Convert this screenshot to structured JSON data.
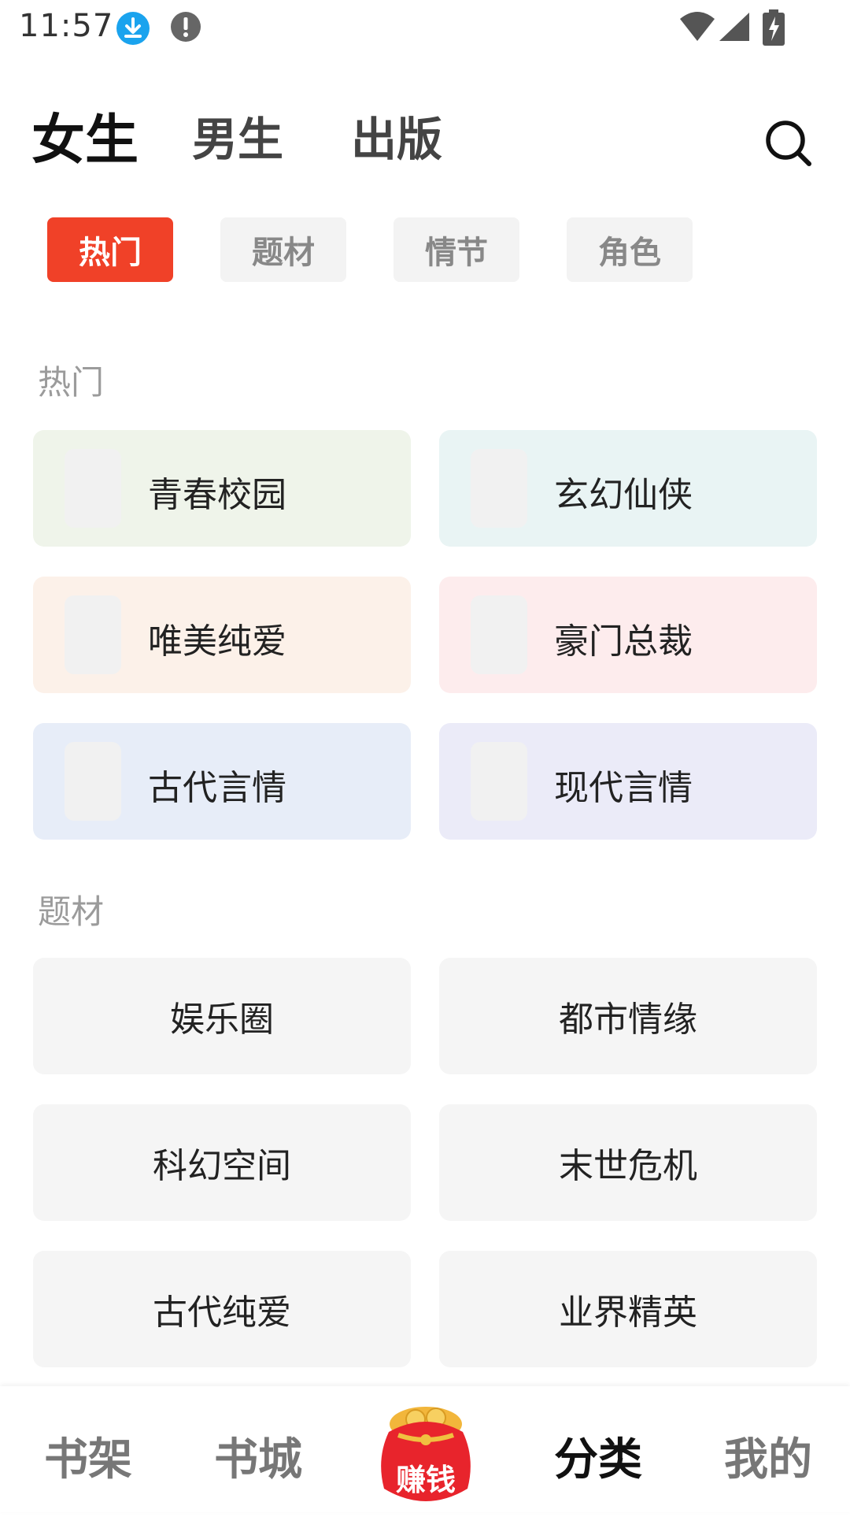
{
  "status_bar": {
    "time": "11:57",
    "icons": [
      "download-icon",
      "alert-icon",
      "wifi-icon",
      "signal-icon",
      "battery-charging-icon"
    ]
  },
  "top_tabs": [
    {
      "label": "女生",
      "active": true
    },
    {
      "label": "男生",
      "active": false
    },
    {
      "label": "出版",
      "active": false
    }
  ],
  "sub_tabs": [
    {
      "label": "热门",
      "active": true
    },
    {
      "label": "题材",
      "active": false
    },
    {
      "label": "情节",
      "active": false
    },
    {
      "label": "角色",
      "active": false
    }
  ],
  "hot_section": {
    "title": "热门",
    "items": [
      {
        "label": "青春校园",
        "bg": "#eff4ea"
      },
      {
        "label": "玄幻仙侠",
        "bg": "#e9f4f4"
      },
      {
        "label": "唯美纯爱",
        "bg": "#fcf1e9"
      },
      {
        "label": "豪门总裁",
        "bg": "#fdeced"
      },
      {
        "label": "古代言情",
        "bg": "#e7edf8"
      },
      {
        "label": "现代言情",
        "bg": "#ebebf8"
      }
    ]
  },
  "genre_section": {
    "title": "题材",
    "items": [
      {
        "label": "娱乐圈"
      },
      {
        "label": "都市情缘"
      },
      {
        "label": "科幻空间"
      },
      {
        "label": "末世危机"
      },
      {
        "label": "古代纯爱"
      },
      {
        "label": "业界精英"
      }
    ]
  },
  "bottom_nav": {
    "items": [
      {
        "label": "书架",
        "active": false
      },
      {
        "label": "书城",
        "active": false
      },
      {
        "label": "分类",
        "active": true
      },
      {
        "label": "我的",
        "active": false
      }
    ],
    "earn_label": "赚钱"
  },
  "colors": {
    "accent": "#f04128",
    "chip_bg": "#f3f3f3",
    "card_bg": "#f5f5f5"
  }
}
